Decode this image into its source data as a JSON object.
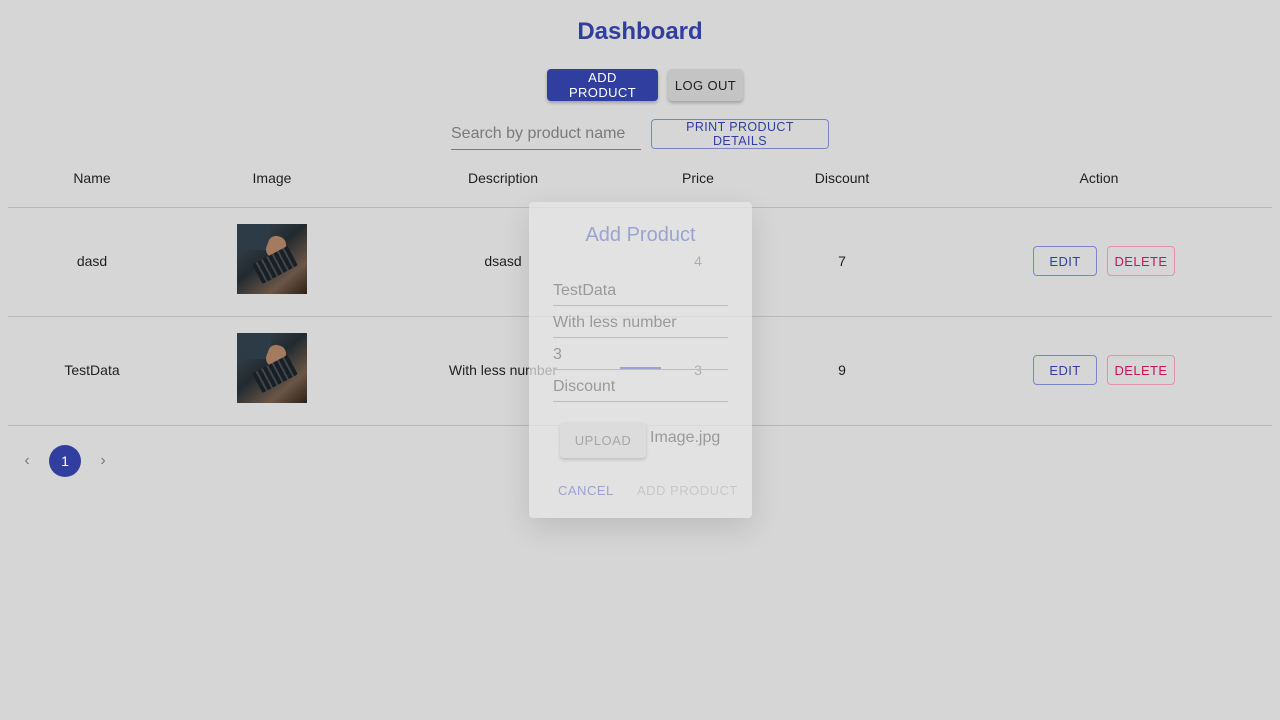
{
  "header": {
    "title": "Dashboard"
  },
  "toolbar": {
    "add_product_label": "ADD PRODUCT",
    "logout_label": "LOG OUT"
  },
  "search": {
    "placeholder": "Search by product name",
    "print_label": "PRINT PRODUCT DETAILS"
  },
  "table": {
    "columns": [
      "Name",
      "Image",
      "Description",
      "Price",
      "Discount",
      "Action"
    ],
    "rows": [
      {
        "name": "dasd",
        "description": "dsasd",
        "price": "4",
        "discount": "7",
        "edit_label": "EDIT",
        "delete_label": "DELETE"
      },
      {
        "name": "TestData",
        "description": "With less number",
        "price": "3",
        "discount": "9",
        "edit_label": "EDIT",
        "delete_label": "DELETE"
      }
    ]
  },
  "pagination": {
    "prev_icon": "chevron-left-icon",
    "current_page": "1",
    "next_icon": "chevron-right-icon"
  },
  "dialog": {
    "title": "Add Product",
    "name_value": "TestData",
    "description_value": "With less number",
    "price_value": "3",
    "discount_placeholder": "Discount",
    "upload_label": "UPLOAD",
    "file_name": "Image.jpg",
    "cancel_label": "CANCEL",
    "submit_label": "ADD PRODUCT"
  },
  "colors": {
    "primary": "#303f9f",
    "danger": "#c2185b",
    "background": "#d6d6d6"
  }
}
